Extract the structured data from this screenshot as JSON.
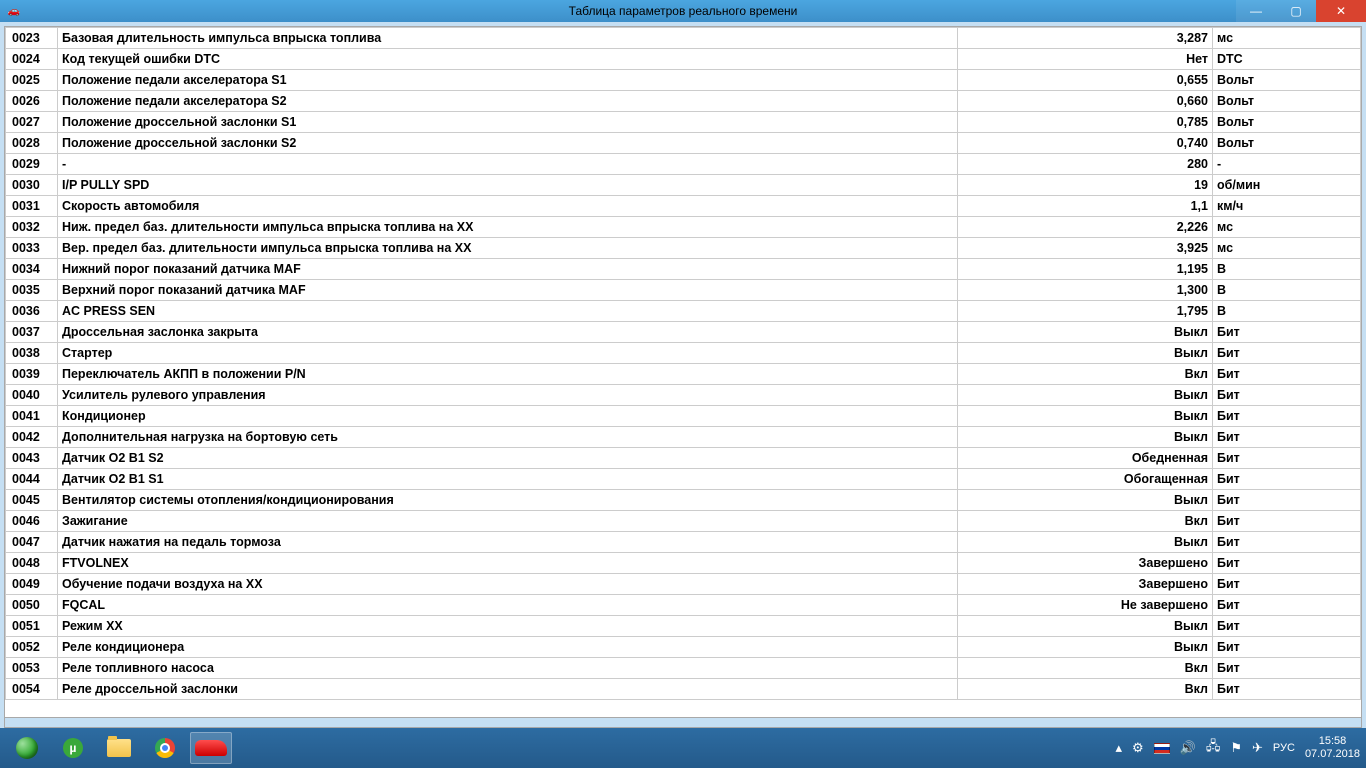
{
  "window": {
    "title": "Таблица параметров реального времени"
  },
  "rows": [
    {
      "id": "0023",
      "name": "Базовая длительность импульса впрыска топлива",
      "value": "3,287",
      "unit": "мс"
    },
    {
      "id": "0024",
      "name": "Код текущей ошибки DTC",
      "value": "Нет",
      "unit": "DTC"
    },
    {
      "id": "0025",
      "name": "Положение педали акселератора S1",
      "value": "0,655",
      "unit": "Вольт"
    },
    {
      "id": "0026",
      "name": "Положение педали акселератора S2",
      "value": "0,660",
      "unit": "Вольт"
    },
    {
      "id": "0027",
      "name": "Положение дроссельной заслонки S1",
      "value": "0,785",
      "unit": "Вольт"
    },
    {
      "id": "0028",
      "name": "Положение дроссельной заслонки S2",
      "value": "0,740",
      "unit": "Вольт"
    },
    {
      "id": "0029",
      "name": "-",
      "value": "280",
      "unit": "-"
    },
    {
      "id": "0030",
      "name": "I/P PULLY SPD",
      "value": "19",
      "unit": "об/мин"
    },
    {
      "id": "0031",
      "name": "Скорость автомобиля",
      "value": "1,1",
      "unit": "км/ч"
    },
    {
      "id": "0032",
      "name": "Ниж. предел баз. длительности импульса впрыска топлива на ХХ",
      "value": "2,226",
      "unit": "мс"
    },
    {
      "id": "0033",
      "name": "Вер. предел баз. длительности импульса впрыска топлива на ХХ",
      "value": "3,925",
      "unit": "мс"
    },
    {
      "id": "0034",
      "name": "Нижний порог показаний датчика MAF",
      "value": "1,195",
      "unit": "В"
    },
    {
      "id": "0035",
      "name": "Верхний порог показаний датчика MAF",
      "value": "1,300",
      "unit": "В"
    },
    {
      "id": "0036",
      "name": "AC PRESS SEN",
      "value": "1,795",
      "unit": "В"
    },
    {
      "id": "0037",
      "name": "Дроссельная заслонка закрыта",
      "value": "Выкл",
      "unit": "Бит"
    },
    {
      "id": "0038",
      "name": "Стартер",
      "value": "Выкл",
      "unit": "Бит"
    },
    {
      "id": "0039",
      "name": "Переключатель АКПП в положении P/N",
      "value": "Вкл",
      "unit": "Бит"
    },
    {
      "id": "0040",
      "name": "Усилитель рулевого управления",
      "value": "Выкл",
      "unit": "Бит"
    },
    {
      "id": "0041",
      "name": "Кондиционер",
      "value": "Выкл",
      "unit": "Бит"
    },
    {
      "id": "0042",
      "name": "Дополнительная нагрузка на бортовую сеть",
      "value": "Выкл",
      "unit": "Бит"
    },
    {
      "id": "0043",
      "name": "Датчик O2 В1 S2",
      "value": "Обедненная",
      "unit": "Бит"
    },
    {
      "id": "0044",
      "name": "Датчик O2 В1 S1",
      "value": "Обогащенная",
      "unit": "Бит"
    },
    {
      "id": "0045",
      "name": "Вентилятор системы отопления/кондиционирования",
      "value": "Выкл",
      "unit": "Бит"
    },
    {
      "id": "0046",
      "name": "Зажигание",
      "value": "Вкл",
      "unit": "Бит"
    },
    {
      "id": "0047",
      "name": "Датчик нажатия на педаль тормоза",
      "value": "Выкл",
      "unit": "Бит"
    },
    {
      "id": "0048",
      "name": "FTVOLNEX",
      "value": "Завершено",
      "unit": "Бит"
    },
    {
      "id": "0049",
      "name": "Обучение подачи воздуха на ХХ",
      "value": "Завершено",
      "unit": "Бит"
    },
    {
      "id": "0050",
      "name": "FQCAL",
      "value": "Не завершено",
      "unit": "Бит"
    },
    {
      "id": "0051",
      "name": "Режим ХХ",
      "value": "Выкл",
      "unit": "Бит"
    },
    {
      "id": "0052",
      "name": "Реле кондиционера",
      "value": "Выкл",
      "unit": "Бит"
    },
    {
      "id": "0053",
      "name": "Реле топливного насоса",
      "value": "Вкл",
      "unit": "Бит"
    },
    {
      "id": "0054",
      "name": "Реле дроссельной заслонки",
      "value": "Вкл",
      "unit": "Бит"
    }
  ],
  "tray": {
    "lang": "РУС",
    "time": "15:58",
    "date": "07.07.2018"
  }
}
